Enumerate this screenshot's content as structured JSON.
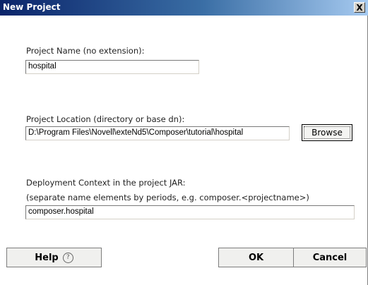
{
  "window": {
    "title": "New Project",
    "close_label": "X"
  },
  "project_name": {
    "label": "Project Name (no extension):",
    "value": "hospital"
  },
  "project_location": {
    "label": "Project Location (directory or base dn):",
    "value": "D:\\Program Files\\Novell\\exteNd5\\Composer\\tutorial\\hospital",
    "browse_label": "Browse"
  },
  "deployment_context": {
    "label": "Deployment Context in the project JAR:",
    "hint": "(separate name elements by periods, e.g. composer.<projectname>)",
    "value": "composer.hospital"
  },
  "buttons": {
    "help_label": "Help",
    "help_icon": "?",
    "ok_label": "OK",
    "cancel_label": "Cancel"
  }
}
